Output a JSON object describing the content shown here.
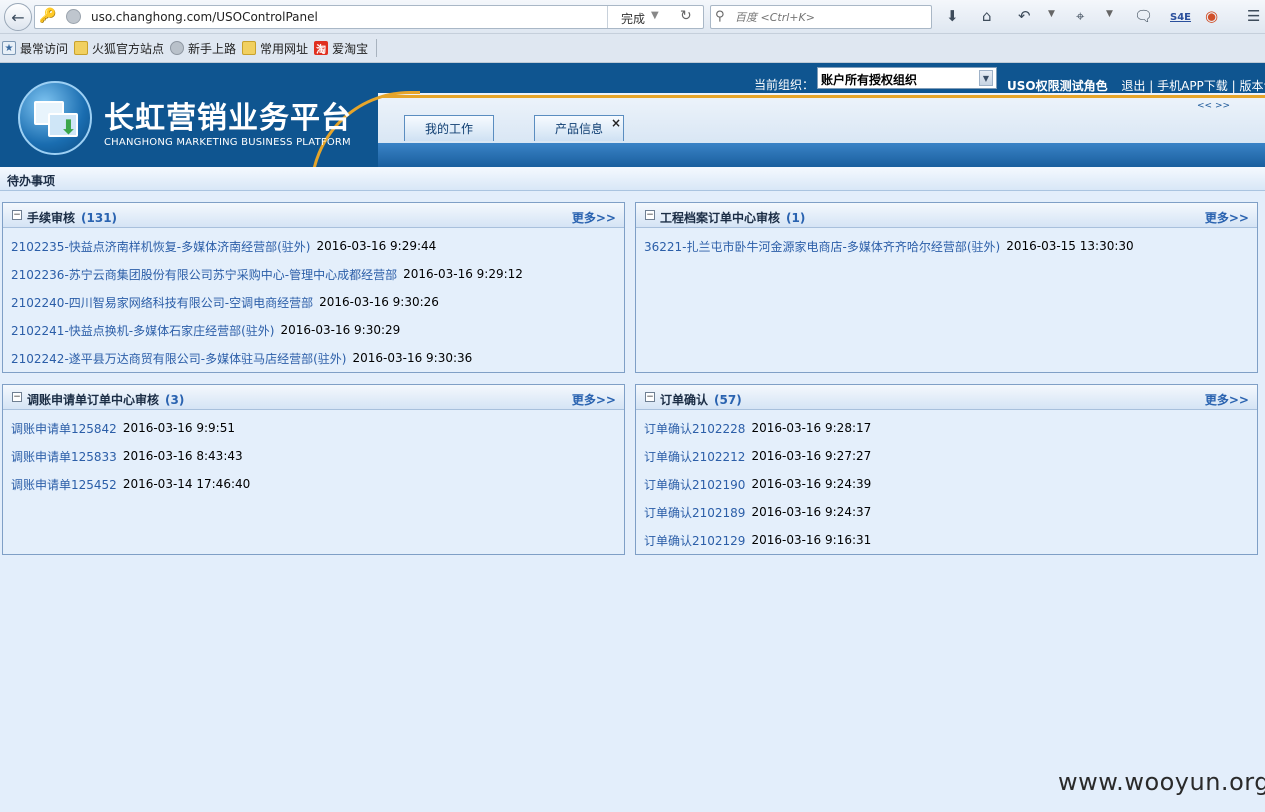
{
  "browser": {
    "url": "uso.changhong.com/USOControlPanel",
    "status": "完成",
    "search_placeholder": "百度 <Ctrl+K>",
    "search_engine_icon": "magnifier-icon",
    "toolbar_extra": "S4E"
  },
  "bookmarks": [
    {
      "label": "最常访问",
      "icon": "doc"
    },
    {
      "label": "火狐官方站点",
      "icon": "folder"
    },
    {
      "label": "新手上路",
      "icon": "circle"
    },
    {
      "label": "常用网址",
      "icon": "folder"
    },
    {
      "label": "爱淘宝",
      "icon": "taobao",
      "icon_text": "淘"
    }
  ],
  "header": {
    "brand_title": "长虹营销业务平台",
    "brand_subtitle": "CHANGHONG MARKETING BUSINESS PLATFORM",
    "org_label": "当前组织：",
    "org_selected": "账户所有授权组织",
    "role": "USO权限测试角色",
    "links": [
      "退出",
      "手机APP下载",
      "版本说"
    ],
    "scroll_arrows": "<< >>",
    "nav_tabs": [
      {
        "label": "我的工作"
      },
      {
        "label": "产品信息",
        "close": "×"
      }
    ]
  },
  "section": {
    "title": "待办事项"
  },
  "panels": [
    {
      "title": "手续审核",
      "count": "(131)",
      "more": "更多>>",
      "items": [
        {
          "text": "2102235-快益点济南样机恢复-多媒体济南经营部(驻外)",
          "time": "2016-03-16 9:29:44"
        },
        {
          "text": "2102236-苏宁云商集团股份有限公司苏宁采购中心-管理中心成都经营部",
          "time": "2016-03-16 9:29:12"
        },
        {
          "text": "2102240-四川智易家网络科技有限公司-空调电商经营部",
          "time": "2016-03-16 9:30:26"
        },
        {
          "text": "2102241-快益点换机-多媒体石家庄经营部(驻外)",
          "time": "2016-03-16 9:30:29"
        },
        {
          "text": "2102242-遂平县万达商贸有限公司-多媒体驻马店经营部(驻外)",
          "time": "2016-03-16 9:30:36"
        }
      ]
    },
    {
      "title": "工程档案订单中心审核",
      "count": "(1)",
      "more": "更多>>",
      "items": [
        {
          "text": "36221-扎兰屯市卧牛河金源家电商店-多媒体齐齐哈尔经营部(驻外)",
          "time": "2016-03-15 13:30:30"
        }
      ]
    },
    {
      "title": "调账申请单订单中心审核",
      "count": "(3)",
      "more": "更多>>",
      "items": [
        {
          "text": "调账申请单125842",
          "time": "2016-03-16 9:9:51"
        },
        {
          "text": "调账申请单125833",
          "time": "2016-03-16 8:43:43"
        },
        {
          "text": "调账申请单125452",
          "time": "2016-03-14 17:46:40"
        }
      ]
    },
    {
      "title": "订单确认",
      "count": "(57)",
      "more": "更多>>",
      "items": [
        {
          "text": "订单确认2102228",
          "time": "2016-03-16 9:28:17"
        },
        {
          "text": "订单确认2102212",
          "time": "2016-03-16 9:27:27"
        },
        {
          "text": "订单确认2102190",
          "time": "2016-03-16 9:24:39"
        },
        {
          "text": "订单确认2102189",
          "time": "2016-03-16 9:24:37"
        },
        {
          "text": "订单确认2102129",
          "time": "2016-03-16 9:16:31"
        }
      ]
    }
  ],
  "watermark": "www.wooyun.org",
  "colors": {
    "header_blue": "#0f5590",
    "accent_gold": "#e6a52a",
    "link_blue": "#2b5ea8",
    "page_bg": "#e3eefb"
  }
}
